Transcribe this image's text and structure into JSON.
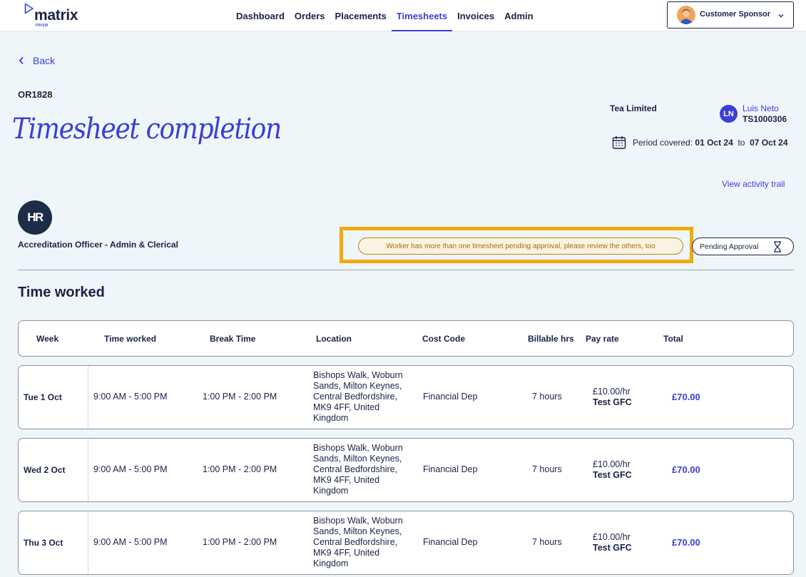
{
  "brand": {
    "name": "matrix",
    "sub": "PRISM",
    "accent": "#3b3ed6"
  },
  "nav": [
    {
      "label": "Dashboard",
      "active": false
    },
    {
      "label": "Orders",
      "active": false
    },
    {
      "label": "Placements",
      "active": false
    },
    {
      "label": "Timesheets",
      "active": true
    },
    {
      "label": "Invoices",
      "active": false
    },
    {
      "label": "Admin",
      "active": false
    }
  ],
  "user": {
    "role": "Customer Sponsor"
  },
  "header": {
    "back_label": "Back",
    "order_id": "OR1828",
    "title": "Timesheet completion",
    "client": "Tea Limited",
    "worker_initials": "LN",
    "worker_name": "Luis Neto",
    "timesheet_id": "TS1000306",
    "period_label": "Period covered:",
    "period_start": "01 Oct 24",
    "period_to": "to",
    "period_end": "07 Oct 24",
    "activity_link": "View activity trail"
  },
  "placement": {
    "logo_text": "HR",
    "role": "Accreditation Officer - Admin & Clerical",
    "warning": "Worker has more than one timesheet pending approval, please review the others, too",
    "status": "Pending Approval"
  },
  "section": {
    "title": "Time worked"
  },
  "table": {
    "headers": [
      "Week",
      "Time worked",
      "Break Time",
      "Location",
      "Cost Code",
      "Billable hrs",
      "Pay rate",
      "Total"
    ],
    "rows": [
      {
        "day": "Tue 1 Oct",
        "time": "9:00 AM - 5:00 PM",
        "break": "1:00 PM - 2:00 PM",
        "location": "Bishops Walk, Woburn Sands, Milton Keynes, Central Bedfordshire, MK9 4FF, United Kingdom",
        "cost_code": "Financial Dep",
        "hours": "7 hours",
        "rate": "£10.00/hr",
        "rate_name": "Test GFC",
        "total": "£70.00"
      },
      {
        "day": "Wed 2 Oct",
        "time": "9:00 AM - 5:00 PM",
        "break": "1:00 PM - 2:00 PM",
        "location": "Bishops Walk, Woburn Sands, Milton Keynes, Central Bedfordshire, MK9 4FF, United Kingdom",
        "cost_code": "Financial Dep",
        "hours": "7 hours",
        "rate": "£10.00/hr",
        "rate_name": "Test GFC",
        "total": "£70.00"
      },
      {
        "day": "Thu 3 Oct",
        "time": "9:00 AM - 5:00 PM",
        "break": "1:00 PM - 2:00 PM",
        "location": "Bishops Walk, Woburn Sands, Milton Keynes, Central Bedfordshire, MK9 4FF, United Kingdom",
        "cost_code": "Financial Dep",
        "hours": "7 hours",
        "rate": "£10.00/hr",
        "rate_name": "Test GFC",
        "total": "£70.00"
      }
    ]
  },
  "icons": {
    "logo": "play-triangle-icon",
    "back": "chevron-left-icon",
    "user_menu": "chevron-down-icon",
    "period": "calendar-icon",
    "status": "hourglass-icon"
  }
}
